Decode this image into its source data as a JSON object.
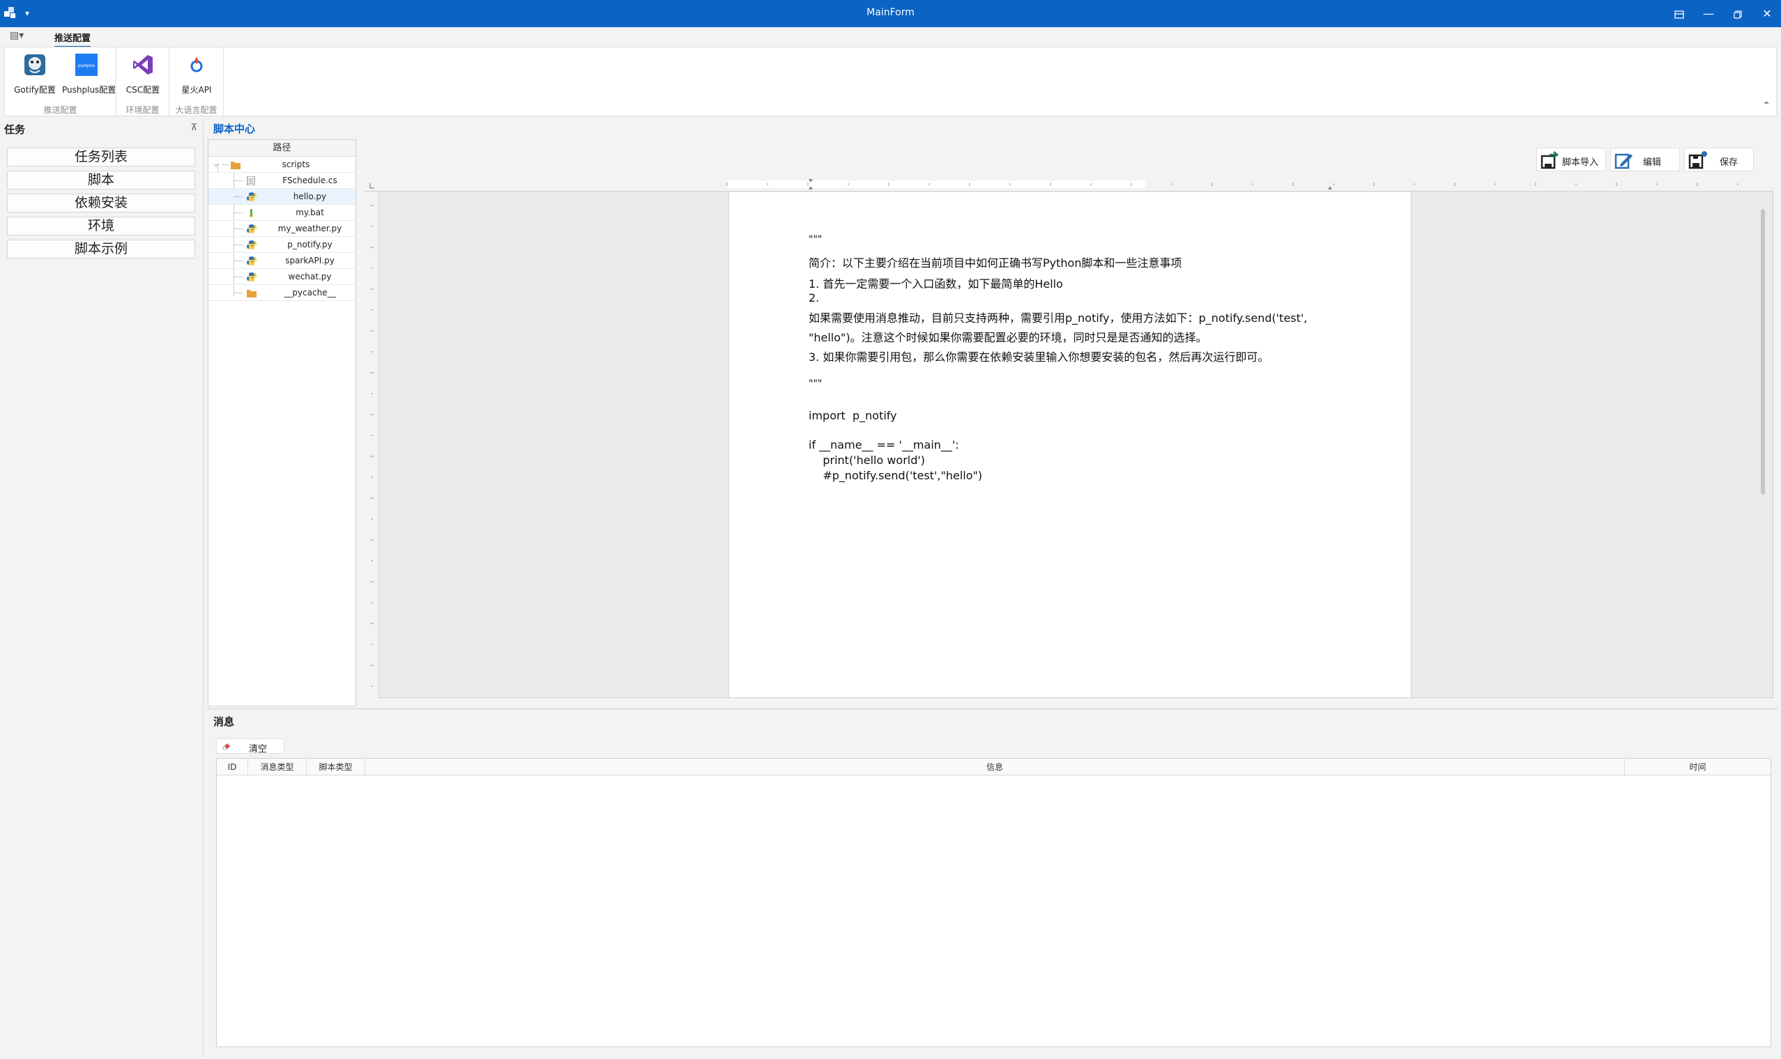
{
  "window": {
    "title": "MainForm",
    "controls": [
      "restore-layout",
      "minimize",
      "maximize",
      "close"
    ]
  },
  "ribbon": {
    "tab": "推送配置",
    "groups": [
      {
        "caption": "推送配置",
        "buttons": [
          {
            "label": "Gotify配置",
            "icon": "gotify-icon"
          },
          {
            "label": "Pushplus配置",
            "icon": "pushplus-icon"
          }
        ]
      },
      {
        "caption": "环境配置",
        "buttons": [
          {
            "label": "CSC配置",
            "icon": "visual-studio-icon"
          }
        ]
      },
      {
        "caption": "大语言配置",
        "buttons": [
          {
            "label": "星火API",
            "icon": "spark-icon"
          }
        ]
      }
    ]
  },
  "left_panel": {
    "title": "任务",
    "items": [
      "任务列表",
      "脚本",
      "依赖安装",
      "环境",
      "脚本示例"
    ]
  },
  "script_center": {
    "title": "脚本中心",
    "tree_header": "路径",
    "tree": [
      {
        "name": "scripts",
        "type": "folder",
        "level": 0
      },
      {
        "name": "FSchedule.cs",
        "type": "cs",
        "level": 1
      },
      {
        "name": "hello.py",
        "type": "py",
        "level": 1,
        "selected": true
      },
      {
        "name": "my.bat",
        "type": "bat",
        "level": 1
      },
      {
        "name": "my_weather.py",
        "type": "py",
        "level": 1
      },
      {
        "name": "p_notify.py",
        "type": "py",
        "level": 1
      },
      {
        "name": "sparkAPI.py",
        "type": "py",
        "level": 1
      },
      {
        "name": "wechat.py",
        "type": "py",
        "level": 1
      },
      {
        "name": "__pycache__",
        "type": "folder",
        "level": 1
      }
    ],
    "toolbar": {
      "import": "脚本导入",
      "edit": "编辑",
      "save": "保存"
    },
    "document_lines": [
      "\"\"\"",
      "简介：以下主要介绍在当前项目中如何正确书写Python脚本和一些注意事项",
      "1. 首先一定需要一个入口函数，如下最简单的Hello",
      "2.",
      "如果需要使用消息推动，目前只支持两种，需要引用p_notify，使用方法如下：p_notify.send('test',",
      "\"hello\")。注意这个时候如果你需要配置必要的环境，同时只是是否通知的选择。",
      "3. 如果你需要引用包，那么你需要在依赖安装里输入你想要安装的包名，然后再次运行即可。",
      "",
      "\"\"\"",
      "",
      "import  p_notify",
      "",
      "if __name__ == '__main__':",
      "    print('hello world')",
      "    #p_notify.send('test',\"hello\")"
    ]
  },
  "messages": {
    "title": "消息",
    "clear": "清空",
    "columns": [
      "ID",
      "消息类型",
      "脚本类型",
      "信息",
      "时间"
    ]
  },
  "colors": {
    "accent": "#0b63c4",
    "title_bar": "#0b63c4"
  }
}
